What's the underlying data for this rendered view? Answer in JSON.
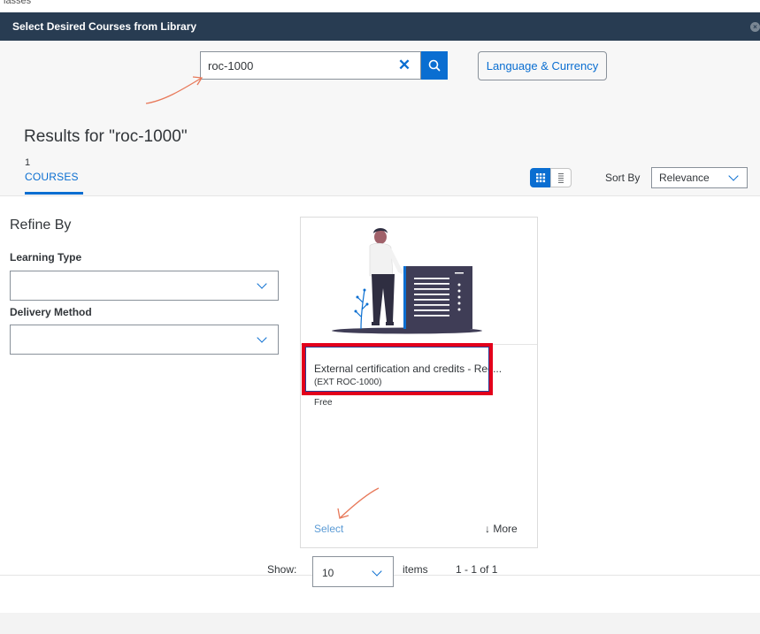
{
  "background_text": "lasses",
  "dialog": {
    "title": "Select Desired Courses from Library",
    "close_icon": "close-icon"
  },
  "search": {
    "value": "roc-1000",
    "clear_icon": "clear-icon",
    "clear_symbol": "✕",
    "search_icon": "search-icon"
  },
  "language_button": "Language & Currency",
  "results": {
    "heading": "Results for \"roc-1000\"",
    "tab_count": "1",
    "tab_label": "COURSES"
  },
  "view_toggle": {
    "grid_icon": "grid-view-icon",
    "list_icon": "list-view-icon"
  },
  "sort": {
    "label": "Sort By",
    "value": "Relevance"
  },
  "refine": {
    "title": "Refine By",
    "learning_type_label": "Learning Type",
    "learning_type_value": "",
    "delivery_method_label": "Delivery Method",
    "delivery_method_value": ""
  },
  "course_card": {
    "title": "External certification and credits - Rec...",
    "code": "(EXT ROC-1000)",
    "price": "Free",
    "select_label": "Select",
    "more_label": "↓ More"
  },
  "pagination": {
    "show_label": "Show:",
    "page_size": "10",
    "items_label": "items",
    "range": "1 - 1  of 1"
  },
  "colors": {
    "header_bg": "#283c52",
    "accent": "#0a6ed1",
    "highlight_red": "#e3001b",
    "annotation_arrow": "#e8795a"
  }
}
